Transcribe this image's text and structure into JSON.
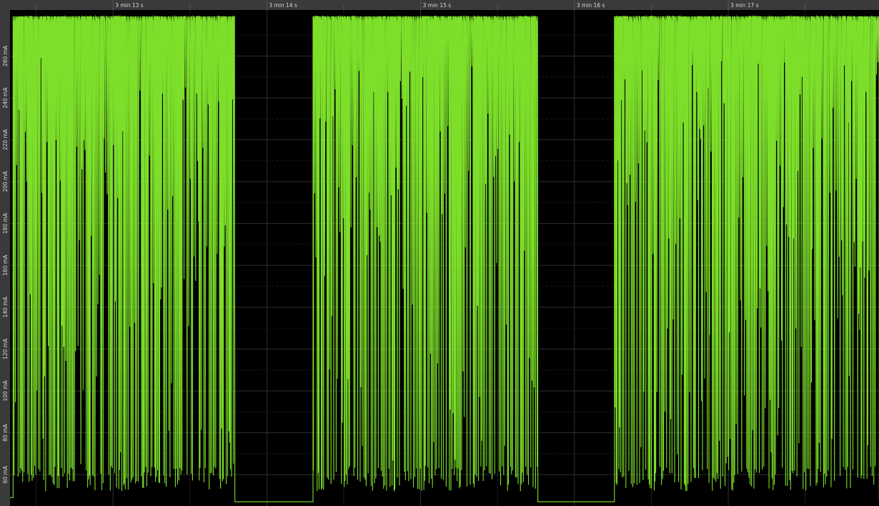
{
  "chart_data": {
    "type": "line",
    "title": "",
    "xlabel": "",
    "ylabel": "",
    "x_ticks": [
      "3 min 13 s",
      "3 min 14 s",
      "3 min 15 s",
      "3 min 16 s",
      "3 min 17 s"
    ],
    "y_ticks": [
      "60 mA",
      "80 mA",
      "100 mA",
      "120 mA",
      "140 mA",
      "160 mA",
      "180 mA",
      "200 mA",
      "220 mA",
      "240 mA",
      "260 mA"
    ],
    "x_range_s": [
      192.33,
      197.98
    ],
    "ylim_mA": [
      45,
      282
    ],
    "grid": true,
    "series": [
      {
        "color": "#7ddf2a",
        "baseline_mA": 49,
        "idle_mA": 47,
        "peak_mA": 279,
        "bursts": [
          {
            "start_s": 192.35,
            "end_s": 193.79,
            "min_mA": 52
          },
          {
            "start_s": 194.3,
            "end_s": 195.76,
            "min_mA": 52
          },
          {
            "start_s": 196.26,
            "end_s": 197.98,
            "min_mA": 52
          }
        ],
        "idle_intervals": [
          {
            "start_s": 193.79,
            "end_s": 194.3,
            "value_mA": 47
          },
          {
            "start_s": 195.76,
            "end_s": 196.26,
            "value_mA": 47
          }
        ]
      }
    ]
  }
}
